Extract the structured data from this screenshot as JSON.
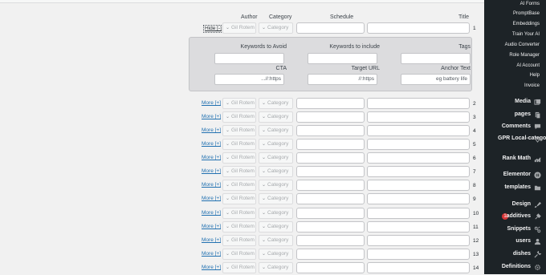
{
  "headers": {
    "author": "Author",
    "category": "Category",
    "schedule": "Schedule",
    "title": "Title"
  },
  "row1": {
    "toggle": "Hide [-]",
    "author": "Gil Rotem",
    "category": "Category",
    "number": "1"
  },
  "panel": {
    "keywords_avoid": "Keywords to Avoid",
    "keywords_include": "Keywords to include",
    "tags": "Tags",
    "cta": "CTA",
    "target_url": "Target URL",
    "anchor_text": "Anchor Text",
    "cta_placeholder": "https://...",
    "target_url_placeholder": "https://",
    "anchor_placeholder": "eg battery life"
  },
  "rows": [
    {
      "toggle": "More [+]",
      "author": "Gil Rotem",
      "category": "Category",
      "number": "2"
    },
    {
      "toggle": "More [+]",
      "author": "Gil Rotem",
      "category": "Category",
      "number": "3"
    },
    {
      "toggle": "More [+]",
      "author": "Gil Rotem",
      "category": "Category",
      "number": "4"
    },
    {
      "toggle": "More [+]",
      "author": "Gil Rotem",
      "category": "Category",
      "number": "5"
    },
    {
      "toggle": "More [+]",
      "author": "Gil Rotem",
      "category": "Category",
      "number": "6"
    },
    {
      "toggle": "More [+]",
      "author": "Gil Rotem",
      "category": "Category",
      "number": "7"
    },
    {
      "toggle": "More [+]",
      "author": "Gil Rotem",
      "category": "Category",
      "number": "8"
    },
    {
      "toggle": "More [+]",
      "author": "Gil Rotem",
      "category": "Category",
      "number": "9"
    },
    {
      "toggle": "More [+]",
      "author": "Gil Rotem",
      "category": "Category",
      "number": "10"
    },
    {
      "toggle": "More [+]",
      "author": "Gil Rotem",
      "category": "Category",
      "number": "11"
    },
    {
      "toggle": "More [+]",
      "author": "Gil Rotem",
      "category": "Category",
      "number": "12"
    },
    {
      "toggle": "More [+]",
      "author": "Gil Rotem",
      "category": "Category",
      "number": "13"
    },
    {
      "toggle": "More [+]",
      "author": "Gil Rotem",
      "category": "Category",
      "number": "14"
    }
  ],
  "sidebar": {
    "submenu": [
      "AI Forms",
      "PromptBase",
      "Embeddings",
      "Train Your AI",
      "Audio Converter",
      "Role Manager",
      "AI Account",
      "Help",
      "Invoice"
    ],
    "menu": [
      {
        "label": "Media",
        "icon": "media-icon"
      },
      {
        "label": "pages",
        "icon": "pages-icon"
      },
      {
        "label": "Comments",
        "icon": "comments-icon"
      },
      {
        "label": "GPR Local-category",
        "icon": "location-pin-icon"
      },
      {
        "label": "Rank Math",
        "icon": "rank-math-icon"
      },
      {
        "label": "Elementor",
        "icon": "elementor-icon"
      },
      {
        "label": "templates",
        "icon": "folder-icon"
      },
      {
        "label": "Design",
        "icon": "brush-icon"
      },
      {
        "label": "additives",
        "icon": "plugin-icon",
        "badge": "1"
      },
      {
        "label": "Snippets",
        "icon": "snippets-icon"
      },
      {
        "label": "users",
        "icon": "user-icon"
      },
      {
        "label": "dishes",
        "icon": "wrench-icon"
      },
      {
        "label": "Definitions",
        "icon": "settings-icon"
      }
    ]
  }
}
